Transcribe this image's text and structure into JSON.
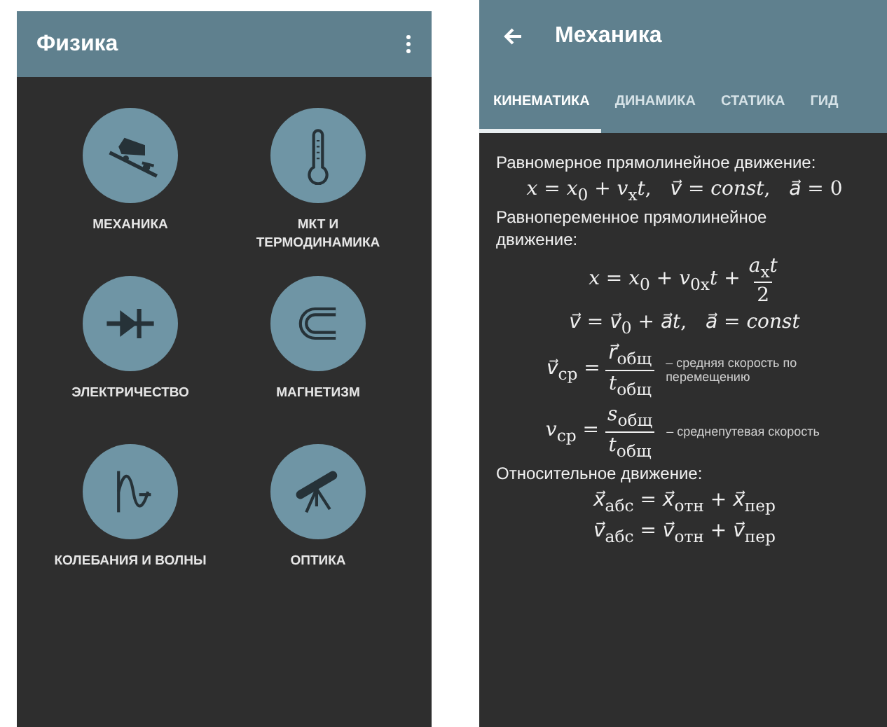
{
  "screens": [
    {
      "kind": "menu",
      "title": "Физика",
      "items": [
        {
          "label": "МЕХАНИКА"
        },
        {
          "label": "МКТ И ТЕРМОДИНАМИКА"
        },
        {
          "label": "ЭЛЕКТРИЧЕСТВО"
        },
        {
          "label": "МАГНЕТИЗМ"
        },
        {
          "label": "КОЛЕБАНИЯ И ВОЛНЫ"
        },
        {
          "label": "ОПТИКА"
        }
      ]
    },
    {
      "kind": "topic",
      "title": "Механика",
      "tabs": [
        {
          "label": "КИНЕМАТИКА",
          "selected": true
        },
        {
          "label": "ДИНАМИКА",
          "selected": false
        },
        {
          "label": "СТАТИКА",
          "selected": false
        },
        {
          "label": "ГИД",
          "selected": false
        }
      ],
      "sections": [
        {
          "heading": "Равномерное прямолинейное движение:",
          "formulas": [
            {
              "parts": [
                {
                  "kind": "text",
                  "text": "*x* = *x*$_{0}$ + *v*$_{x}$*t*,   *v⃗* = *const*,   *a⃗* = 0"
                }
              ]
            }
          ]
        },
        {
          "heading": "Равнопеременное прямолинейное движение:",
          "formulas": [
            {
              "parts": [
                {
                  "kind": "text",
                  "text": "*x* = *x*$_{0}$ + *v*$_{0x}$*t* +"
                },
                {
                  "kind": "fraction",
                  "numerator": "*a*$_{x}$*t*",
                  "denominator": "2"
                }
              ]
            },
            {
              "parts": [
                {
                  "kind": "text",
                  "text": "*v⃗* = *v⃗*$_{0}$ + *a⃗t*,   *a⃗* = *const*"
                }
              ]
            },
            {
              "parts": [
                {
                  "kind": "text",
                  "text": "*v⃗*$_{ср}$ ="
                },
                {
                  "kind": "fraction",
                  "numerator": "*r⃗*$_{общ}$",
                  "denominator": "*t*$_{общ}$"
                }
              ],
              "note": "– средняя скорость по перемещению"
            },
            {
              "parts": [
                {
                  "kind": "text",
                  "text": "*v*$_{ср}$ ="
                },
                {
                  "kind": "fraction",
                  "numerator": "*s*$_{общ}$",
                  "denominator": "*t*$_{общ}$"
                }
              ],
              "note": "– среднепутевая скорость"
            }
          ]
        },
        {
          "heading": "Относительное движение:",
          "formulas": [
            {
              "parts": [
                {
                  "kind": "text",
                  "text": "*x⃗*$_{абс}$ = *x⃗*$_{отн}$ + *x⃗*$_{пер}$"
                }
              ]
            },
            {
              "parts": [
                {
                  "kind": "text",
                  "text": "*v⃗*$_{абс}$ = *v⃗*$_{отн}$ + *v⃗*$_{пер}$"
                }
              ]
            }
          ]
        }
      ]
    }
  ]
}
